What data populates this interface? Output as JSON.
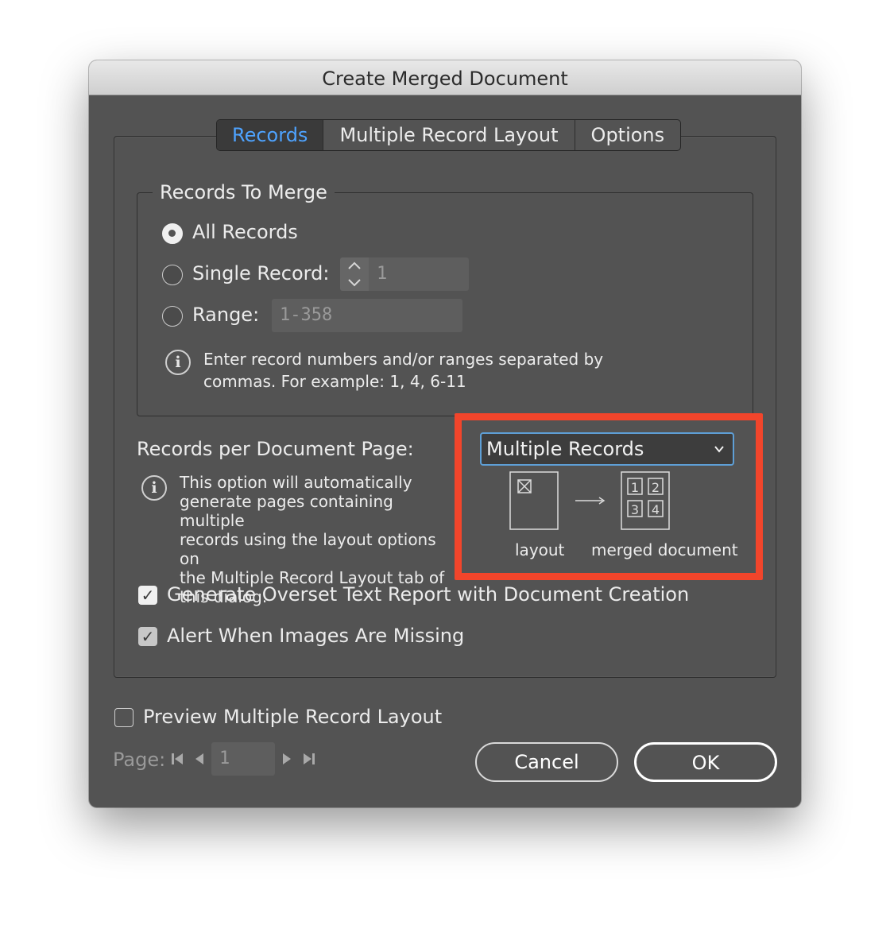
{
  "window": {
    "title": "Create Merged Document"
  },
  "tabs": [
    {
      "label": "Records",
      "active": true
    },
    {
      "label": "Multiple Record Layout",
      "active": false
    },
    {
      "label": "Options",
      "active": false
    }
  ],
  "records_to_merge": {
    "title": "Records To Merge",
    "all_records": {
      "label": "All Records",
      "selected": true
    },
    "single_record": {
      "label": "Single Record:",
      "value": "1",
      "selected": false
    },
    "range": {
      "label": "Range:",
      "placeholder": "1-358",
      "selected": false
    },
    "info_line1": "Enter record numbers and/or ranges separated by",
    "info_line2": "commas. For example: 1, 4, 6-11"
  },
  "records_per_page": {
    "label": "Records per Document Page:",
    "selected": "Multiple Records",
    "info_lines": [
      "This option will automatically",
      "generate pages containing multiple",
      "records using the layout options on",
      "the Multiple Record Layout tab of",
      "this dialog."
    ],
    "diagram": {
      "layout_label": "layout",
      "merged_label": "merged document",
      "cells": [
        "1",
        "2",
        "3",
        "4"
      ]
    }
  },
  "checkboxes": {
    "overset": {
      "label": "Generate Overset Text Report with Document Creation",
      "checked": true
    },
    "missing_images": {
      "label": "Alert When Images Are Missing",
      "checked": true
    }
  },
  "preview": {
    "label": "Preview Multiple Record Layout",
    "checked": false,
    "page_label": "Page:",
    "page_value": "1"
  },
  "buttons": {
    "cancel": "Cancel",
    "ok": "OK"
  },
  "colors": {
    "accent": "#4ea3ff",
    "highlight": "#f2452b",
    "dialog_bg": "#535353"
  }
}
